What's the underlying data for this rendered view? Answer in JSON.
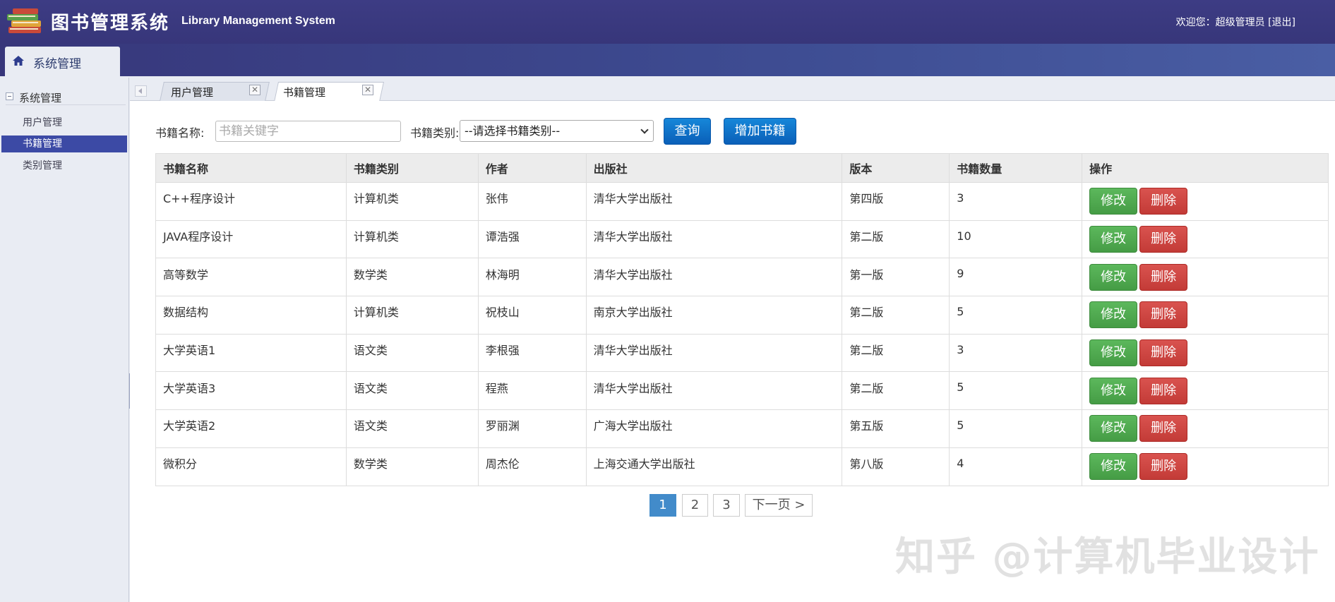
{
  "header": {
    "title": "图书管理系统",
    "subtitle": "Library Management System",
    "welcome": "欢迎您：超级管理员",
    "logout": "[退出]"
  },
  "module_tab": {
    "label": "系统管理"
  },
  "sidebar": {
    "group": "系统管理",
    "items": [
      {
        "label": "用户管理"
      },
      {
        "label": "书籍管理"
      },
      {
        "label": "类别管理"
      }
    ]
  },
  "tabs": [
    {
      "label": "用户管理"
    },
    {
      "label": "书籍管理"
    }
  ],
  "search": {
    "name_label": "书籍名称:",
    "name_placeholder": "书籍关键字",
    "category_label": "书籍类别:",
    "category_selected": "--请选择书籍类别--",
    "query_button": "查询",
    "add_button": "增加书籍"
  },
  "table": {
    "headers": [
      "书籍名称",
      "书籍类别",
      "作者",
      "出版社",
      "版本",
      "书籍数量",
      "操作"
    ],
    "rows": [
      [
        "C++程序设计",
        "计算机类",
        "张伟",
        "清华大学出版社",
        "第四版",
        "3"
      ],
      [
        "JAVA程序设计",
        "计算机类",
        "谭浩强",
        "清华大学出版社",
        "第二版",
        "10"
      ],
      [
        "高等数学",
        "数学类",
        "林海明",
        "清华大学出版社",
        "第一版",
        "9"
      ],
      [
        "数据结构",
        "计算机类",
        "祝枝山",
        "南京大学出版社",
        "第二版",
        "5"
      ],
      [
        "大学英语1",
        "语文类",
        "李根强",
        "清华大学出版社",
        "第二版",
        "3"
      ],
      [
        "大学英语3",
        "语文类",
        "程燕",
        "清华大学出版社",
        "第二版",
        "5"
      ],
      [
        "大学英语2",
        "语文类",
        "罗丽渊",
        "广海大学出版社",
        "第五版",
        "5"
      ],
      [
        "微积分",
        "数学类",
        "周杰伦",
        "上海交通大学出版社",
        "第八版",
        "4"
      ]
    ],
    "edit_label": "修改",
    "delete_label": "删除"
  },
  "pagination": {
    "pages": [
      "1",
      "2",
      "3"
    ],
    "next": "下一页 >",
    "current": "1"
  },
  "watermark": "知乎 @计算机毕业设计",
  "colors": {
    "header_bg": "#3d3c84",
    "sidebar_active": "#3c4aa5",
    "primary_button": "#0a6fc8",
    "edit_button": "#5cb85c",
    "delete_button": "#d9534f",
    "page_active": "#428bca"
  }
}
